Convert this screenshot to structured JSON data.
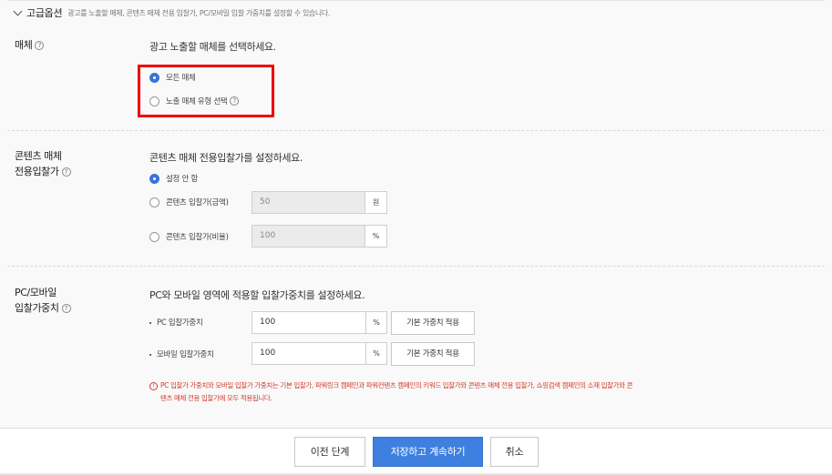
{
  "advanced": {
    "title": "고급옵션",
    "description": "광고를 노출할 매체, 콘텐츠 매체 전용 입찰가, PC/모바일 입찰 가중치를 설정할 수 있습니다."
  },
  "media": {
    "label": "매체",
    "description": "광고 노출할 매체를 선택하세요.",
    "options": [
      {
        "label": "모든 매체",
        "selected": true
      },
      {
        "label": "노출 매체 유형 선택",
        "selected": false
      }
    ]
  },
  "content_bid": {
    "label_line1": "콘텐츠 매체",
    "label_line2": "전용입찰가",
    "description": "콘텐츠 매체 전용입찰가를 설정하세요.",
    "options": [
      {
        "label": "설정 안 함",
        "selected": true
      },
      {
        "label": "콘텐츠 입찰가(금액)",
        "selected": false,
        "value": "50",
        "unit": "원"
      },
      {
        "label": "콘텐츠 입찰가(비율)",
        "selected": false,
        "value": "100",
        "unit": "%"
      }
    ]
  },
  "bid_weight": {
    "label_line1": "PC/모바일",
    "label_line2": "입찰가중치",
    "description": "PC와 모바일 영역에 적용할 입찰가중치를 설정하세요.",
    "rows": [
      {
        "label": "PC 입찰가중치",
        "value": "100",
        "unit": "%",
        "button": "기본 가중치 적용"
      },
      {
        "label": "모바일 입찰가중치",
        "value": "100",
        "unit": "%",
        "button": "기본 가중치 적용"
      }
    ],
    "notice_line1": "PC 입찰가 가중치와 모바일 입찰가 가중치는 기본 입찰가, 파워링크 캠페인과 파워컨텐츠 캠페인의 키워드 입찰가와 콘텐츠 매체 전용 입찰가, 쇼핑검색 캠페인의 소재 입찰가와 콘",
    "notice_line2": "텐츠 매체 전용 입찰가에 모두 적용됩니다."
  },
  "help_icon_text": "?",
  "warn_icon_text": "!",
  "footer": {
    "prev": "이전 단계",
    "save": "저장하고 계속하기",
    "cancel": "취소"
  },
  "colors": {
    "accent": "#3d80e0",
    "highlight_box": "#ee0000",
    "notice": "#d23a2a"
  }
}
